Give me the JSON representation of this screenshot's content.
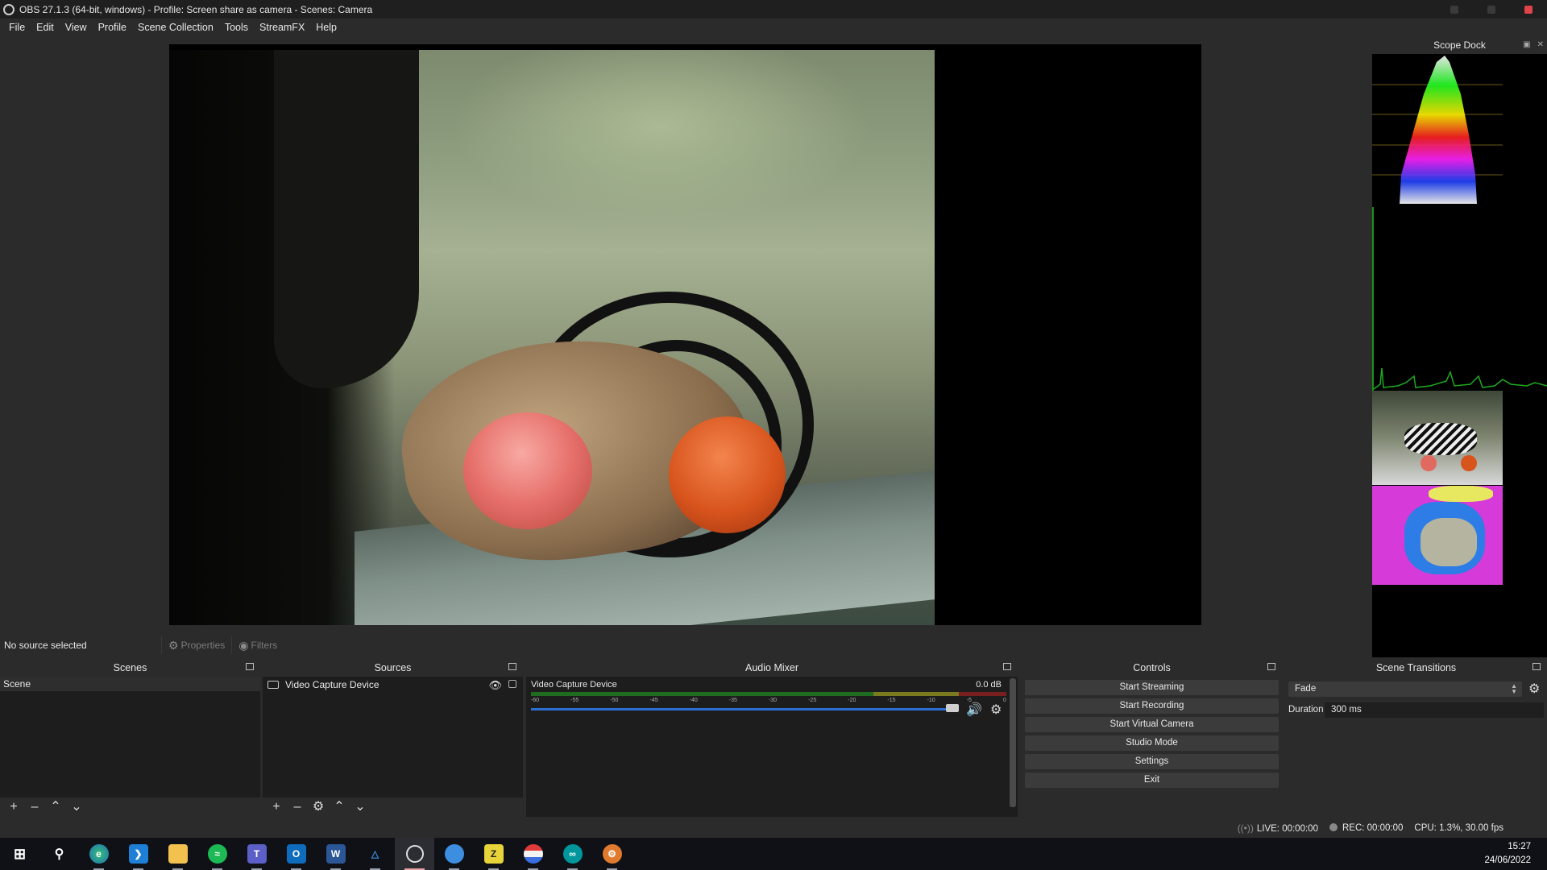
{
  "window": {
    "title": "OBS 27.1.3 (64-bit, windows) - Profile: Screen share as camera - Scenes: Camera"
  },
  "menu": {
    "items": [
      "File",
      "Edit",
      "View",
      "Profile",
      "Scene Collection",
      "Tools",
      "StreamFX",
      "Help"
    ]
  },
  "scope_dock": {
    "title": "Scope Dock"
  },
  "source_toolbar": {
    "status": "No source selected",
    "properties_label": "Properties",
    "filters_label": "Filters"
  },
  "scenes": {
    "title": "Scenes",
    "items": [
      "Scene"
    ]
  },
  "sources": {
    "title": "Sources",
    "items": [
      "Video Capture Device"
    ]
  },
  "mixer": {
    "title": "Audio Mixer",
    "channel_name": "Video Capture Device",
    "channel_db": "0.0 dB",
    "ticks": [
      "-60",
      "-55",
      "-50",
      "-45",
      "-40",
      "-35",
      "-30",
      "-25",
      "-20",
      "-15",
      "-10",
      "-5",
      "0"
    ],
    "fader_level": 1.0
  },
  "controls": {
    "title": "Controls",
    "buttons": [
      "Start Streaming",
      "Start Recording",
      "Start Virtual Camera",
      "Studio Mode",
      "Settings",
      "Exit"
    ]
  },
  "transitions": {
    "title": "Scene Transitions",
    "selected": "Fade",
    "duration_label": "Duration",
    "duration_value": "300 ms"
  },
  "status": {
    "live": "LIVE: 00:00:00",
    "rec": "REC: 00:00:00",
    "cpu": "CPU: 1.3%, 30.00 fps"
  },
  "taskbar": {
    "time": "15:27",
    "date": "24/06/2022",
    "apps": [
      "start",
      "search",
      "edge-dev",
      "vscode",
      "file-explorer",
      "spotify",
      "teams",
      "outlook",
      "word",
      "network-tool",
      "obs",
      "browser",
      "filezilla",
      "app-stripes",
      "arduino",
      "settings-app"
    ]
  },
  "colors": {
    "background": "#2b2b2b",
    "panel": "#1d1d1d",
    "fader": "#2d6fd1",
    "close": "#e0444a"
  }
}
